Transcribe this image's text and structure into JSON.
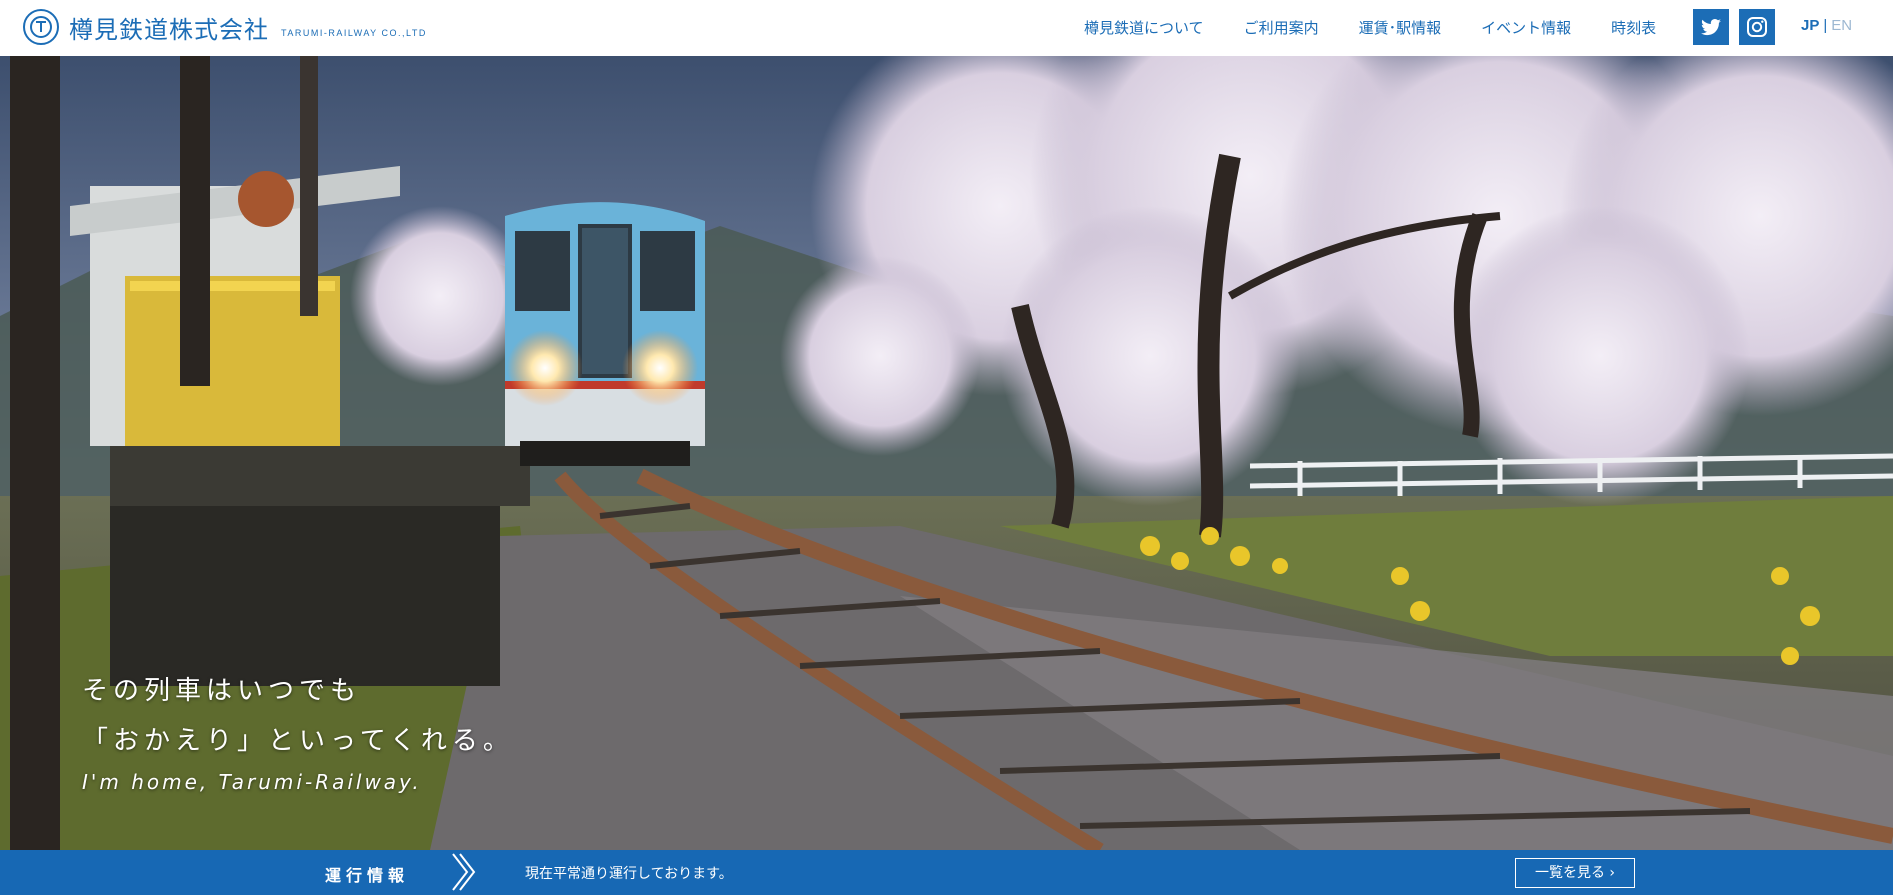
{
  "brand": {
    "name": "樽見鉄道株式会社",
    "sub": "TARUMI-RAILWAY CO.,LTD"
  },
  "nav": {
    "items": [
      {
        "label": "樽見鉄道について"
      },
      {
        "label": "ご利用案内"
      },
      {
        "label": "運賃･駅情報"
      },
      {
        "label": "イベント情報"
      },
      {
        "label": "時刻表"
      }
    ]
  },
  "social": {
    "twitter": "twitter-icon",
    "instagram": "instagram-icon"
  },
  "lang": {
    "jp": "JP",
    "separator": "|",
    "en": "EN"
  },
  "hero": {
    "line1": "その列車はいつでも",
    "line2": "「おかえり」といってくれる。",
    "line3": "I'm home, Tarumi-Railway."
  },
  "status": {
    "title": "運行情報",
    "message": "現在平常通り運行しております。",
    "button": "一覧を見る ›"
  },
  "colors": {
    "brand_blue": "#1c6db6",
    "status_bar": "#1768b4"
  }
}
